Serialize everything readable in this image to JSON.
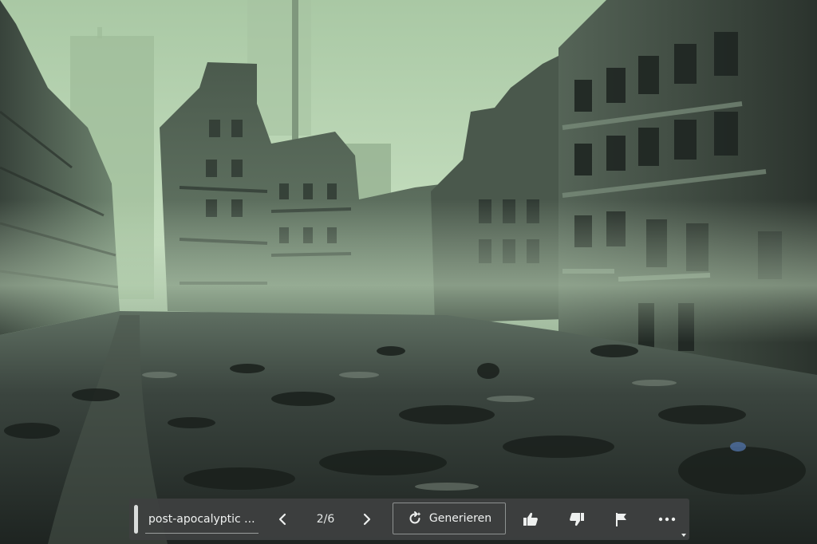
{
  "toolbar": {
    "prompt_text": "post-apocalyptic ...",
    "counter": "2/6",
    "generate_label": "Generieren",
    "prev_icon": "chevron-left-icon",
    "next_icon": "chevron-right-icon",
    "generate_icon": "regenerate-icon",
    "like_icon": "thumbs-up-icon",
    "dislike_icon": "thumbs-down-icon",
    "flag_icon": "flag-icon",
    "more_icon": "more-icon"
  },
  "colors": {
    "toolbar_bg": "#3e4040",
    "toolbar_text": "#e9ecea",
    "sky": "#b9d6b4",
    "ground": "#2d332f"
  }
}
